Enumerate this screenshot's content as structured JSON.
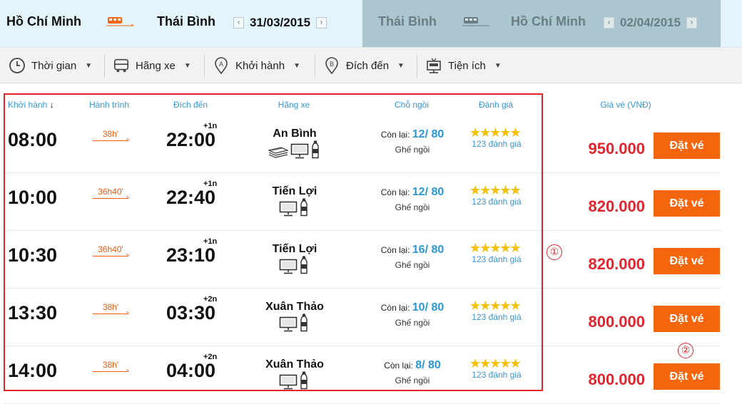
{
  "route": {
    "outbound": {
      "from": "Hồ Chí Minh",
      "to": "Thái Bình",
      "date": "31/03/2015"
    },
    "return": {
      "from": "Thái Bình",
      "to": "Hồ Chí Minh",
      "date": "02/04/2015"
    },
    "prev_symbol": "‹",
    "next_symbol": "›"
  },
  "filters": [
    {
      "label": "Thời gian",
      "icon": "clock-icon"
    },
    {
      "label": "Hãng xe",
      "icon": "bus-icon"
    },
    {
      "label": "Khởi hành",
      "icon": "pin-a-icon"
    },
    {
      "label": "Đích đến",
      "icon": "pin-b-icon"
    },
    {
      "label": "Tiện ích",
      "icon": "amenity-icon"
    }
  ],
  "columns": {
    "departure": "Khởi hành",
    "journey": "Hành trình",
    "destination": "Đích đến",
    "operator": "Hãng xe",
    "seats": "Chỗ ngồi",
    "rating": "Đánh giá",
    "price": "Giá vé (VNĐ)"
  },
  "trips": [
    {
      "depart": "08:00",
      "duration": "38h'",
      "arrive": "22:00",
      "plus": "+1n",
      "operator": "An Bình",
      "amenities": [
        "blanket-icon",
        "tv-icon",
        "water-bottle-icon"
      ],
      "seats_label": "Còn lại:",
      "seats": "12/ 80",
      "seat_type": "Ghế ngồi",
      "stars": "★★★★★",
      "reviews": "123 đánh giá",
      "price": "950.000",
      "book": "Đặt vé"
    },
    {
      "depart": "10:00",
      "duration": "36h40'",
      "arrive": "22:40",
      "plus": "+1n",
      "operator": "Tiến Lợi",
      "amenities": [
        "tv-icon",
        "water-bottle-icon"
      ],
      "seats_label": "Còn lại:",
      "seats": "12/ 80",
      "seat_type": "Ghế ngồi",
      "stars": "★★★★★",
      "reviews": "123 đánh giá",
      "price": "820.000",
      "book": "Đặt vé"
    },
    {
      "depart": "10:30",
      "duration": "36h40'",
      "arrive": "23:10",
      "plus": "+1n",
      "operator": "Tiến Lợi",
      "amenities": [
        "tv-icon",
        "water-bottle-icon"
      ],
      "seats_label": "Còn lại:",
      "seats": "16/ 80",
      "seat_type": "Ghế ngồi",
      "stars": "★★★★★",
      "reviews": "123 đánh giá",
      "price": "820.000",
      "book": "Đặt vé"
    },
    {
      "depart": "13:30",
      "duration": "38h'",
      "arrive": "03:30",
      "plus": "+2n",
      "operator": "Xuân Thảo",
      "amenities": [
        "tv-icon",
        "water-bottle-icon"
      ],
      "seats_label": "Còn lại:",
      "seats": "10/ 80",
      "seat_type": "Ghế ngồi",
      "stars": "★★★★★",
      "reviews": "123 đánh giá",
      "price": "800.000",
      "book": "Đặt vé"
    },
    {
      "depart": "14:00",
      "duration": "38h'",
      "arrive": "04:00",
      "plus": "+2n",
      "operator": "Xuân Thảo",
      "amenities": [
        "tv-icon",
        "water-bottle-icon"
      ],
      "seats_label": "Còn lại:",
      "seats": "8/ 80",
      "seat_type": "Ghế ngồi",
      "stars": "★★★★★",
      "reviews": "123 đánh giá",
      "price": "800.000",
      "book": "Đặt vé"
    }
  ],
  "markers": [
    "①",
    "②"
  ],
  "colors": {
    "accent": "#f5650d",
    "price": "#e0252f",
    "link": "#3a96d4",
    "header_bg": "#e3f5fb",
    "return_bg": "#aac6cf"
  }
}
